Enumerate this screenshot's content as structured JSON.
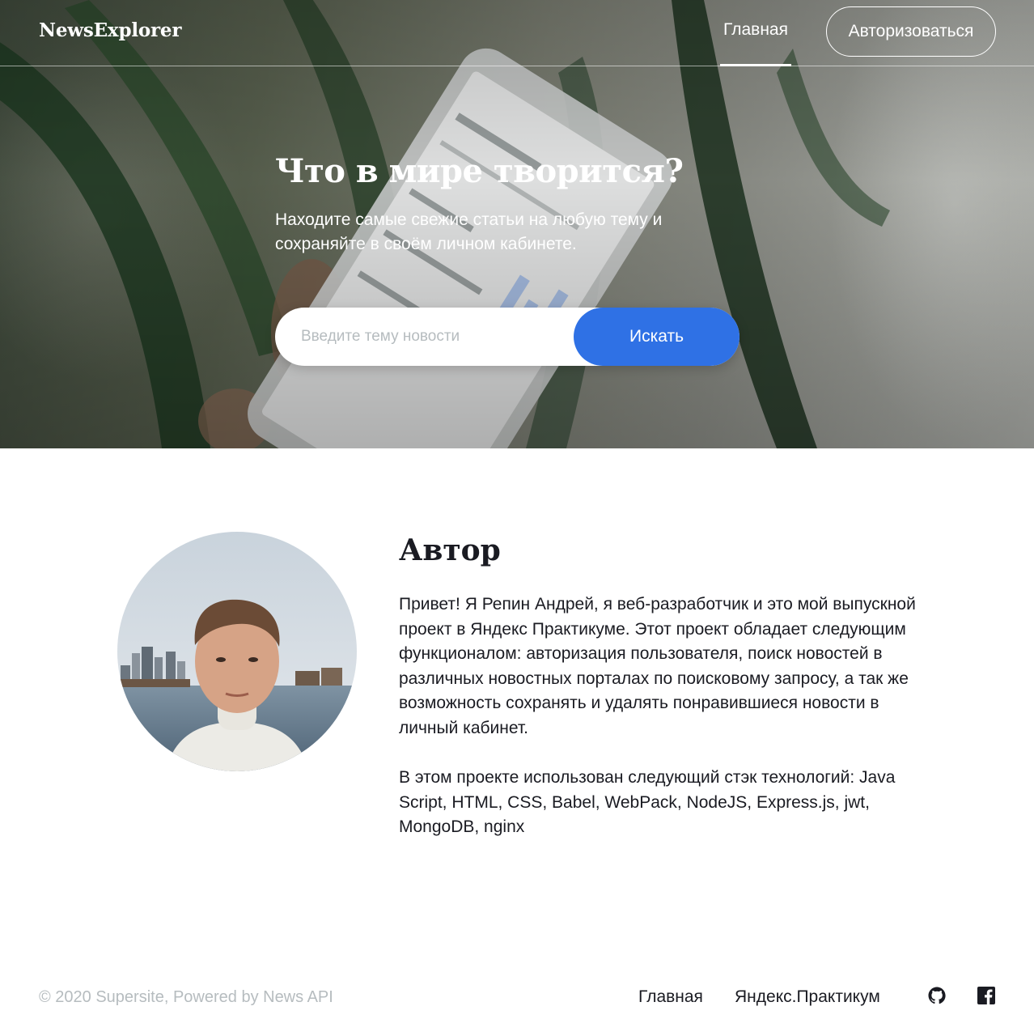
{
  "header": {
    "logo": "NewsExplorer",
    "nav_home": "Главная",
    "auth_button": "Авторизоваться"
  },
  "hero": {
    "title": "Что в мире творится?",
    "subtitle": "Находите самые свежие статьи на любую тему и сохраняйте в своём личном кабинете.",
    "search_placeholder": "Введите тему новости",
    "search_button": "Искать"
  },
  "about": {
    "title": "Автор",
    "paragraph_1": "Привет! Я Репин Андрей, я веб-разработчик и это мой выпускной проект в Яндекс Практикуме. Этот проект обладает следующим функционалом: авторизация пользователя, поиск новостей в различных новостных порталах по поисковому запросу, а так же возможность сохранять и удалять понравившиеся новости в личный кабинет.",
    "paragraph_2": "В этом проекте использован следующий стэк технологий: Java Script, HTML, CSS, Babel, WebPack, NodeJS, Express.js, jwt, MongoDB, nginx"
  },
  "footer": {
    "copyright": "© 2020 Supersite, Powered by News API",
    "links": [
      "Главная",
      "Яндекс.Практикум"
    ],
    "icons": [
      "github-icon",
      "facebook-icon"
    ]
  },
  "colors": {
    "accent": "#2f71e5",
    "text": "#1a1b22",
    "muted": "#b6bcbf"
  }
}
